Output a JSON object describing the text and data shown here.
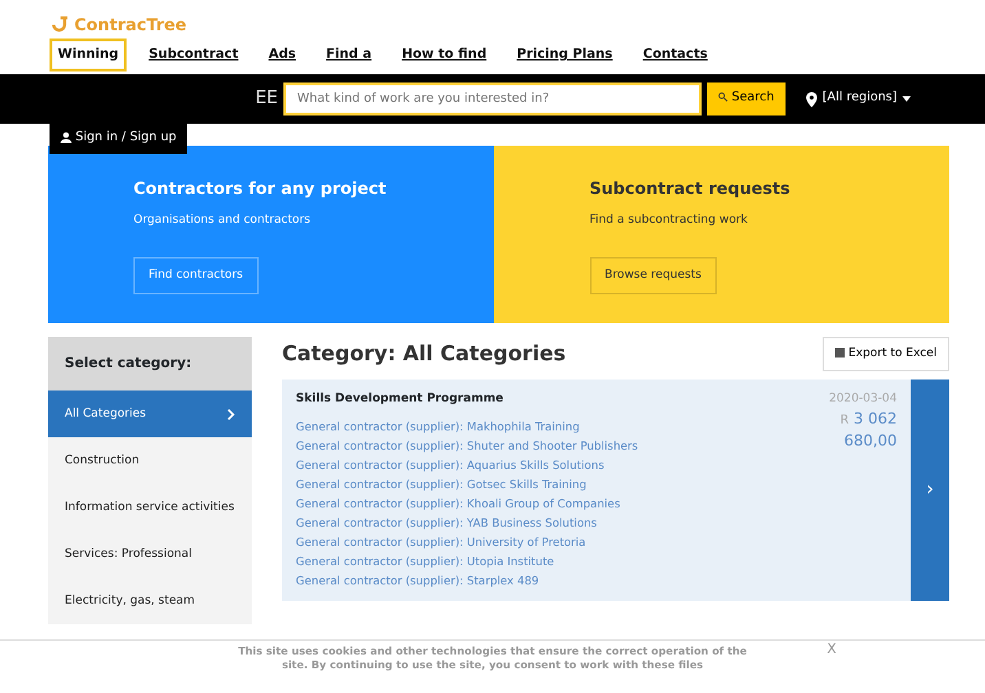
{
  "logo": {
    "text": "ContracTree"
  },
  "nav": [
    {
      "label": "Winning",
      "selected": true
    },
    {
      "label": "Subcontract",
      "selected": false
    },
    {
      "label": "Ads",
      "selected": false
    },
    {
      "label": "Find a",
      "selected": false
    },
    {
      "label": "How to find",
      "selected": false
    },
    {
      "label": "Pricing Plans",
      "selected": false
    },
    {
      "label": "Contacts",
      "selected": false
    }
  ],
  "topbar": {
    "brand_fragment": "EE",
    "search_placeholder": "What kind of work are you interested in?",
    "search_button": "Search",
    "region": "[All regions]",
    "sign_in": "Sign in / Sign up"
  },
  "banner": [
    {
      "title": "Contractors for any project",
      "subtitle": "Organisations and contractors",
      "button": "Find contractors"
    },
    {
      "title": "Subcontract requests",
      "subtitle": "Find a subcontracting work",
      "button": "Browse requests"
    }
  ],
  "sidebar": {
    "title": "Select category:",
    "items": [
      {
        "label": "All Categories",
        "selected": true
      },
      {
        "label": "Construction",
        "selected": false
      },
      {
        "label": "Information service activities",
        "selected": false
      },
      {
        "label": "Services: Professional",
        "selected": false
      },
      {
        "label": "Electricity, gas, steam",
        "selected": false
      }
    ]
  },
  "content": {
    "title": "Category: All Categories",
    "export_button": "Export to Excel",
    "tenders": [
      {
        "title": "Skills Development Programme",
        "date": "2020-03-04",
        "amount_currency": "R",
        "amount": "3 062 680,00",
        "arrow": "›",
        "contractors": [
          "General contractor (supplier): Makhophila Training",
          "General contractor (supplier): Shuter and Shooter Publishers",
          "General contractor (supplier): Aquarius Skills Solutions",
          "General contractor (supplier): Gotsec Skills Training",
          "General contractor (supplier): Khoali Group of Companies",
          "General contractor (supplier): YAB Business Solutions",
          "General contractor (supplier): University of Pretoria",
          "General contractor (supplier): Utopia Institute",
          "General contractor (supplier): Starplex 489"
        ]
      }
    ]
  },
  "cookie": {
    "text": "This site uses cookies and other technologies that ensure the correct operation of the site. By continuing to use the site, you consent to work with these files",
    "close": "X"
  }
}
